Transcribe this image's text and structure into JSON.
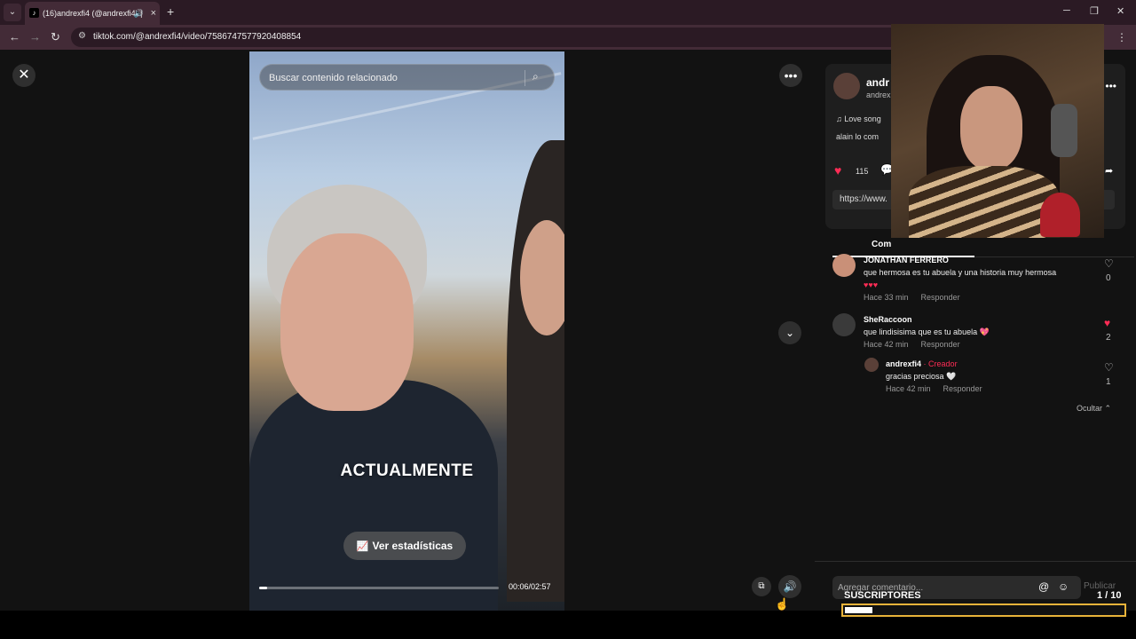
{
  "browser": {
    "tab_title": "(16)andrexfi4 (@andrexfi4) | ",
    "tab_favicon": "tiktok-icon",
    "url": "tiktok.com/@andrexfi4/video/7586747577920408854",
    "new_tab_symbol": "+",
    "back_symbol": "←",
    "forward_symbol": "→",
    "reload_symbol": "↻",
    "minimize_symbol": "─",
    "restore_symbol": "❐",
    "close_symbol": "✕"
  },
  "video": {
    "search_placeholder": "Buscar contenido relacionado",
    "caption": "ACTUALMENTE",
    "stats_button": "Ver estadísticas",
    "time": "00:06/02:57",
    "progress_fraction": 0.034
  },
  "panel": {
    "username": "andr",
    "handle": "andrex",
    "music": "♫  Love song",
    "mention": "alain lo com",
    "like_count": "115",
    "link": "https://www.",
    "comments_tab": "Com",
    "comments": [
      {
        "user": "JONATHAN FERRERO",
        "text": "que hermosa es tu abuela y una historia muy hermosa",
        "emoji": "♥♥♥",
        "time": "Hace 33 min",
        "reply": "Responder",
        "likes": "0",
        "liked": false
      },
      {
        "user": "SheRaccoon",
        "text": "que lindisisima que es tu abuela 💖",
        "time": "Hace 42 min",
        "reply": "Responder",
        "likes": "2",
        "liked": true
      },
      {
        "user": "andrexfi4",
        "creator_label": "· Creador",
        "text": "gracias preciosa 🤍",
        "time": "Hace 42 min",
        "reply": "Responder",
        "likes": "1",
        "liked": false
      }
    ],
    "hide_label": "Ocultar ⌃",
    "comment_placeholder": "Agregar comentario...",
    "publish": "Publicar"
  },
  "overlay": {
    "subs_label": "SUSCRIPTORES",
    "subs_count": "1  / 10",
    "subs_fraction": 0.1,
    "goal_border_color": "#e8b33a"
  },
  "colors": {
    "accent": "#fe2c55"
  }
}
